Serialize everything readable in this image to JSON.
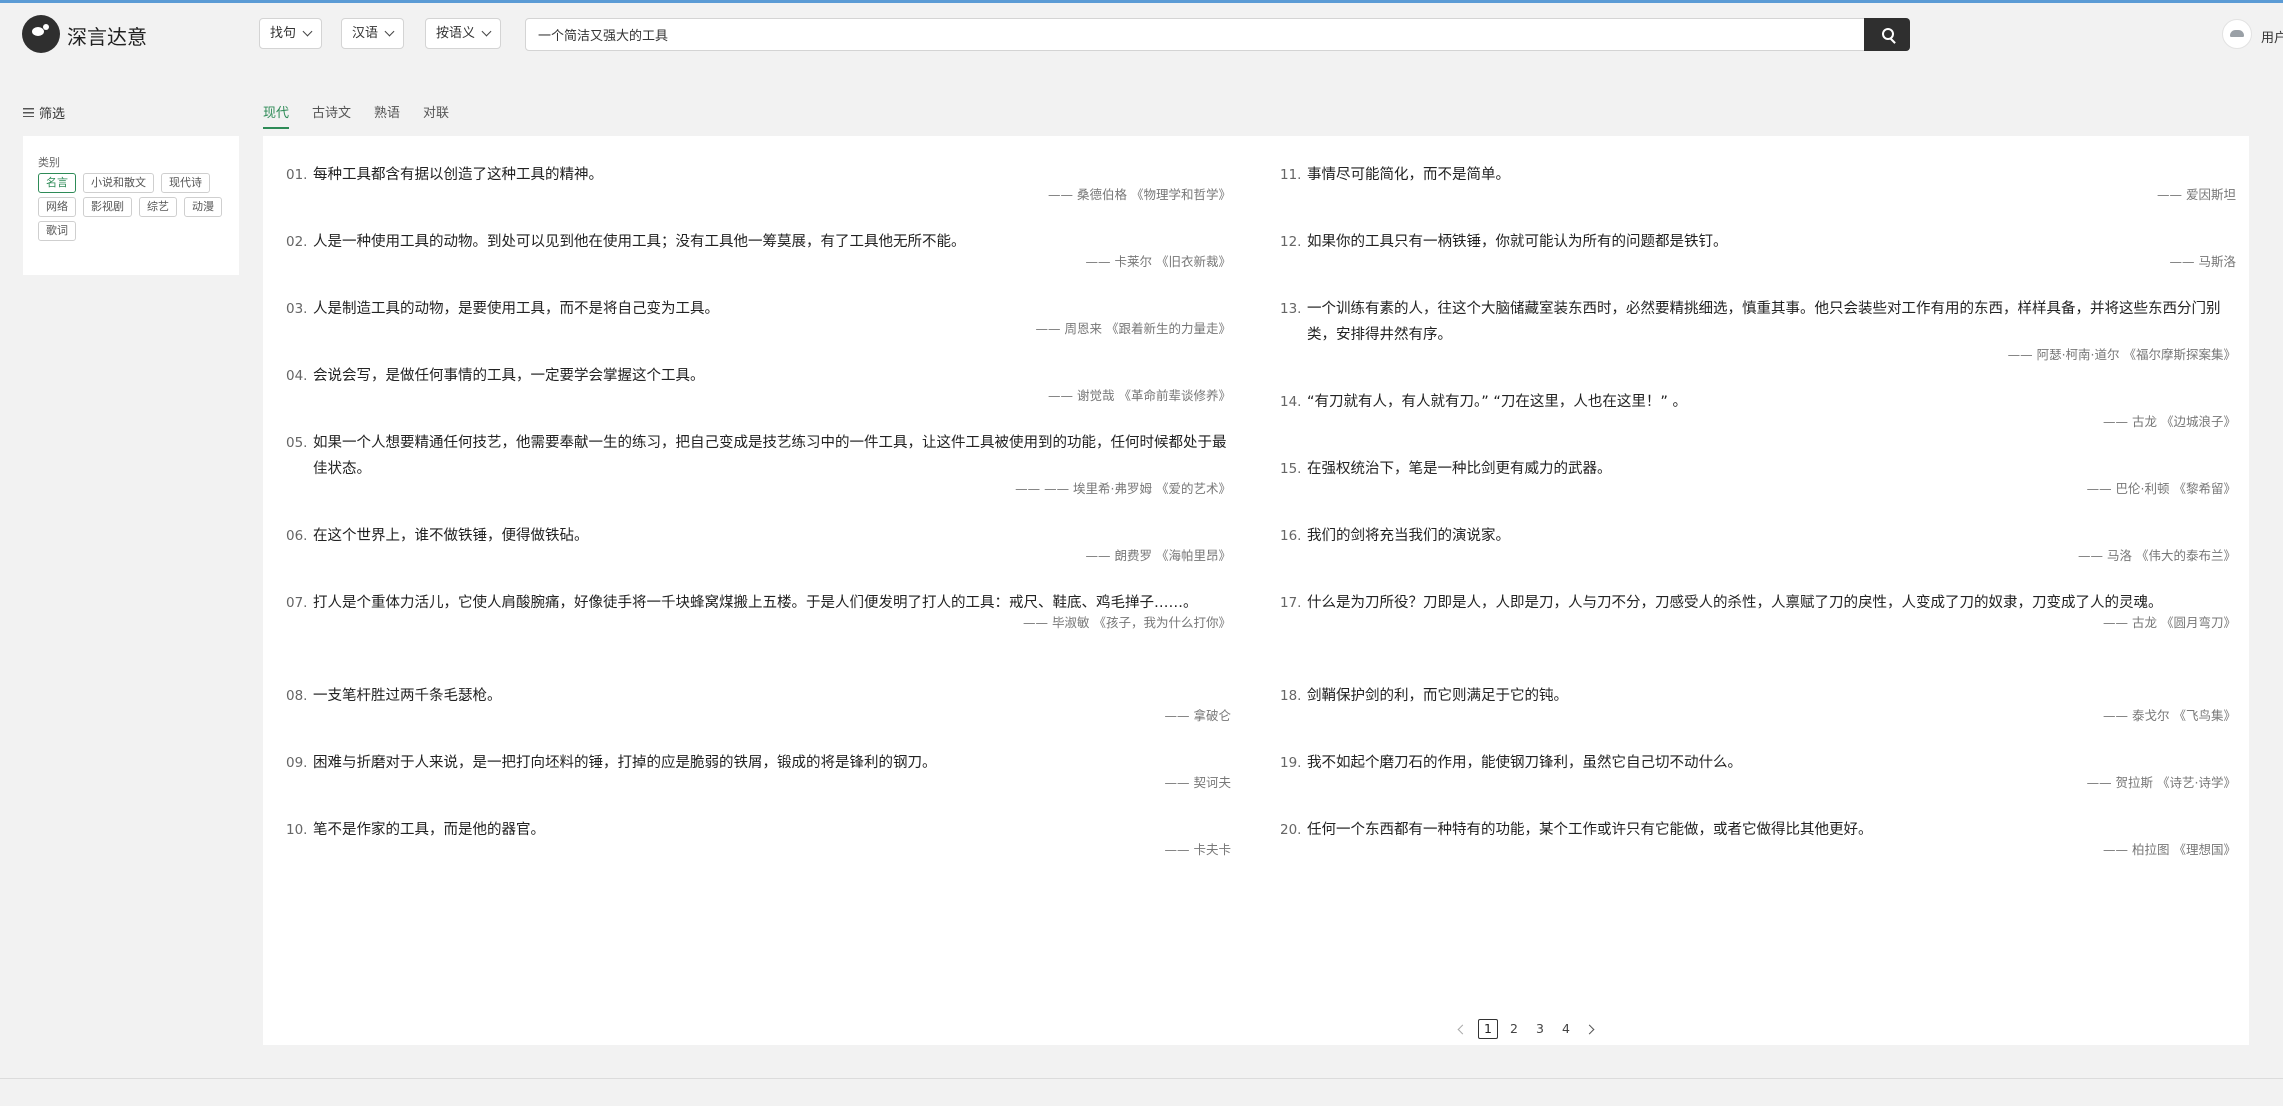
{
  "app": {
    "brand": "深言达意",
    "user_label": "用户"
  },
  "header": {
    "dropdowns": [
      {
        "label": "找句"
      },
      {
        "label": "汉语"
      },
      {
        "label": "按语义"
      }
    ],
    "search": {
      "value": "一个简洁又强大的工具"
    }
  },
  "sidebar": {
    "title": "筛选",
    "category_label": "类别",
    "tags": [
      {
        "label": "名言",
        "active": true
      },
      {
        "label": "小说和散文"
      },
      {
        "label": "现代诗"
      },
      {
        "label": "网络"
      },
      {
        "label": "影视剧"
      },
      {
        "label": "综艺"
      },
      {
        "label": "动漫"
      },
      {
        "label": "歌词"
      }
    ]
  },
  "tabs": [
    {
      "label": "现代",
      "active": true
    },
    {
      "label": "古诗文"
    },
    {
      "label": "熟语"
    },
    {
      "label": "对联"
    }
  ],
  "results_left": [
    {
      "num": "01.",
      "text": "每种工具都含有据以创造了这种工具的精神。",
      "author": "—— 桑德伯格 《物理学和哲学》"
    },
    {
      "num": "02.",
      "text": "人是一种使用工具的动物。到处可以见到他在使用工具；没有工具他一筹莫展，有了工具他无所不能。",
      "author": "—— 卡莱尔 《旧衣新裁》"
    },
    {
      "num": "03.",
      "text": "人是制造工具的动物，是要使用工具，而不是将自己变为工具。",
      "author": "—— 周恩来 《跟着新生的力量走》"
    },
    {
      "num": "04.",
      "text": "会说会写，是做任何事情的工具，一定要学会掌握这个工具。",
      "author": "—— 谢觉哉 《革命前辈谈修养》"
    },
    {
      "num": "05.",
      "text": "如果一个人想要精通任何技艺，他需要奉献一生的练习，把自己变成是技艺练习中的一件工具，让这件工具被使用到的功能，任何时候都处于最佳状态。",
      "author": "—— —— 埃里希·弗罗姆 《爱的艺术》"
    },
    {
      "num": "06.",
      "text": "在这个世界上，谁不做铁锤，便得做铁砧。",
      "author": "—— 朗费罗 《海帕里昂》"
    },
    {
      "num": "07.",
      "text": "打人是个重体力活儿，它使人肩酸腕痛，好像徒手将一千块蜂窝煤搬上五楼。于是人们便发明了打人的工具：戒尺、鞋底、鸡毛掸子……。",
      "author": "—— 毕淑敏 《孩子，我为什么打你》"
    },
    {
      "num": "08.",
      "text": "一支笔杆胜过两千条毛瑟枪。",
      "author": "—— 拿破仑"
    },
    {
      "num": "09.",
      "text": "困难与折磨对于人来说，是一把打向坯料的锤，打掉的应是脆弱的铁屑，锻成的将是锋利的钢刀。",
      "author": "—— 契诃夫"
    },
    {
      "num": "10.",
      "text": "笔不是作家的工具，而是他的器官。",
      "author": "—— 卡夫卡"
    }
  ],
  "results_right": [
    {
      "num": "11.",
      "text": "事情尽可能简化，而不是简单。",
      "author": "—— 爱因斯坦"
    },
    {
      "num": "12.",
      "text": "如果你的工具只有一柄铁锤，你就可能认为所有的问题都是铁钉。",
      "author": "—— 马斯洛"
    },
    {
      "num": "13.",
      "text": "一个训练有素的人，往这个大脑储藏室装东西时，必然要精挑细选，慎重其事。他只会装些对工作有用的东西，样样具备，并将这些东西分门别类，安排得井然有序。",
      "author": "—— 阿瑟·柯南·道尔 《福尔摩斯探案集》"
    },
    {
      "num": "14.",
      "text": "“有刀就有人，有人就有刀。” “刀在这里，人也在这里！” 。",
      "author": "—— 古龙 《边城浪子》"
    },
    {
      "num": "15.",
      "text": "在强权统治下，笔是一种比剑更有威力的武器。",
      "author": "—— 巴伦·利顿 《黎希留》"
    },
    {
      "num": "16.",
      "text": "我们的剑将充当我们的演说家。",
      "author": "—— 马洛 《伟大的泰布兰》"
    },
    {
      "num": "17.",
      "text": "什么是为刀所役？刀即是人，人即是刀，人与刀不分，刀感受人的杀性，人禀赋了刀的戾性，人变成了刀的奴隶，刀变成了人的灵魂。",
      "author": "—— 古龙 《圆月弯刀》"
    },
    {
      "num": "18.",
      "text": "剑鞘保护剑的利，而它则满足于它的钝。",
      "author": "—— 泰戈尔 《飞鸟集》"
    },
    {
      "num": "19.",
      "text": "我不如起个磨刀石的作用，能使钢刀锋利，虽然它自己切不动什么。",
      "author": "—— 贺拉斯 《诗艺·诗学》"
    },
    {
      "num": "20.",
      "text": "任何一个东西都有一种特有的功能，某个工作或许只有它能做，或者它做得比其他更好。",
      "author": "—— 柏拉图 《理想国》"
    }
  ],
  "pagination": {
    "pages": [
      "1",
      "2",
      "3",
      "4"
    ],
    "current": "1"
  }
}
